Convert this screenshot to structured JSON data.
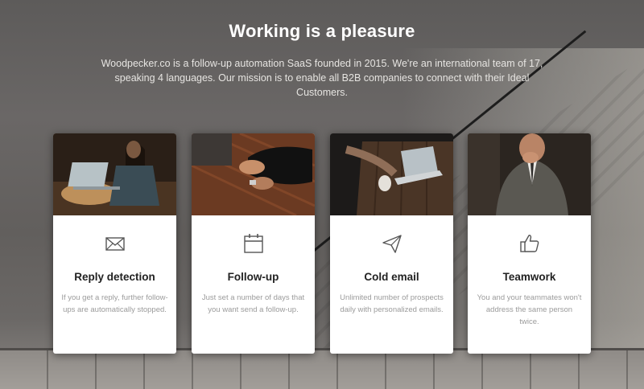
{
  "header": {
    "title": "Working is a pleasure",
    "subtitle": "Woodpecker.co is a follow-up automation SaaS founded in 2015. We're an international team of 17, speaking 4 languages. Our mission is to enable all B2B companies to connect with their Ideal Customers."
  },
  "features": [
    {
      "title": "Reply detection",
      "description": "If you get a reply, further follow-ups are automatically stopped.",
      "icon": "envelope-icon"
    },
    {
      "title": "Follow-up",
      "description": "Just set a number of days that you want send a follow-up.",
      "icon": "calendar-icon"
    },
    {
      "title": "Cold email",
      "description": "Unlimited number of prospects daily with personalized emails.",
      "icon": "paper-plane-icon"
    },
    {
      "title": "Teamwork",
      "description": "You and your teammates won't address the same person twice.",
      "icon": "thumbs-up-icon"
    }
  ],
  "colors": {
    "card_background": "#ffffff",
    "title_text": "#ffffff",
    "feature_title": "#222222",
    "feature_description": "#9b9b9b",
    "icon_stroke": "#555555"
  }
}
